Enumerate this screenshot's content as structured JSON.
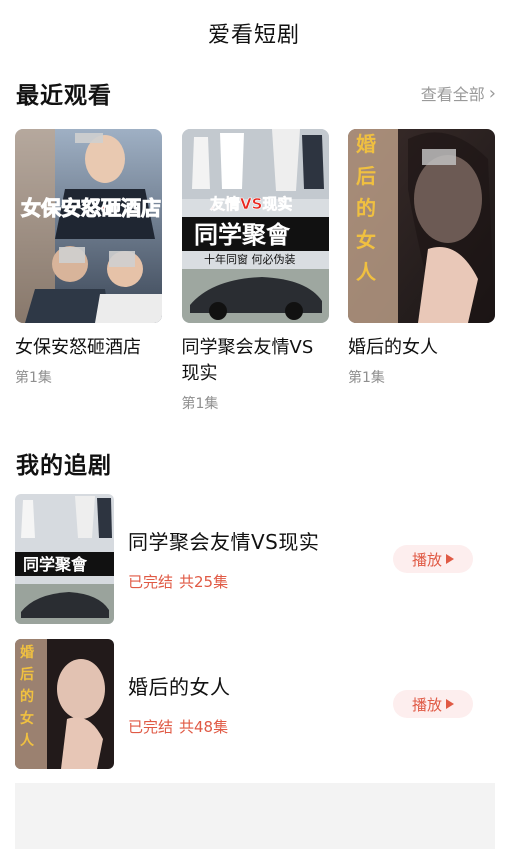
{
  "header": {
    "title": "爱看短剧"
  },
  "recent": {
    "heading": "最近观看",
    "view_all": "查看全部",
    "items": [
      {
        "title": "女保安怒砸酒店",
        "episode": "第1集",
        "poster_text": "女保安怒砸酒店"
      },
      {
        "title": "同学聚会友情VS现实",
        "episode": "第1集",
        "poster_text_top": "友情VS现实",
        "poster_text_main": "同学聚會",
        "poster_text_sub": "十年同窗 何必伪装"
      },
      {
        "title": "婚后的女人",
        "episode": "第1集",
        "poster_text": "婚后的女人"
      }
    ]
  },
  "following": {
    "heading": "我的追剧",
    "items": [
      {
        "title": "同学聚会友情VS现实",
        "status": "已完结",
        "count": "共25集",
        "play": "播放"
      },
      {
        "title": "婚后的女人",
        "status": "已完结",
        "count": "共48集",
        "play": "播放"
      }
    ]
  },
  "colors": {
    "accent": "#e05a45",
    "accent_bg": "#fdeeee",
    "muted": "#9a9a9a"
  }
}
